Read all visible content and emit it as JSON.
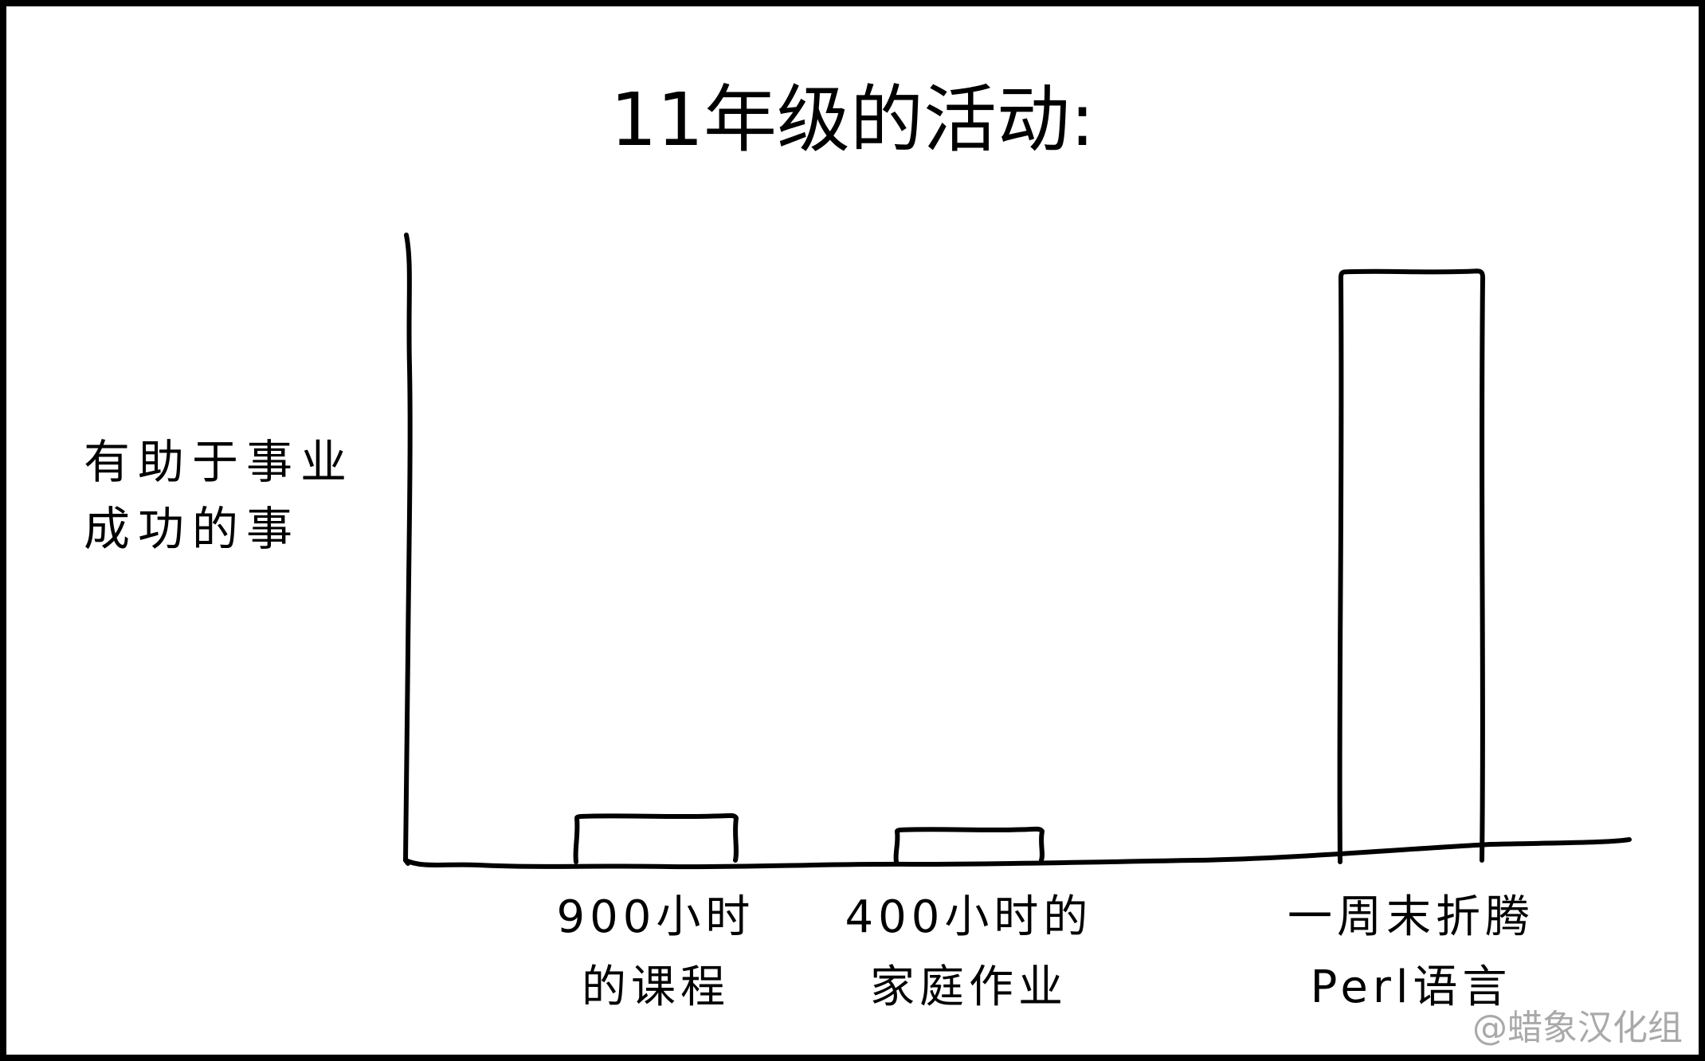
{
  "chart_data": {
    "type": "bar",
    "title": "11年级的活动:",
    "ylabel_lines": [
      "有助于事业",
      "成功的事"
    ],
    "xlabel": "",
    "ylim": [
      0,
      100
    ],
    "categories": [
      {
        "lines": [
          "900小时",
          "的课程"
        ]
      },
      {
        "lines": [
          "400小时的",
          "家庭作业"
        ]
      },
      {
        "lines": [
          "一周末折腾",
          "Perl语言"
        ]
      }
    ],
    "values": [
      7,
      5,
      88
    ],
    "grid": false,
    "legend": "none"
  },
  "credit": "@蜡象汉化组",
  "colors": {
    "ink": "#000000",
    "background": "#ffffff",
    "credit": "#a9a9a9"
  }
}
